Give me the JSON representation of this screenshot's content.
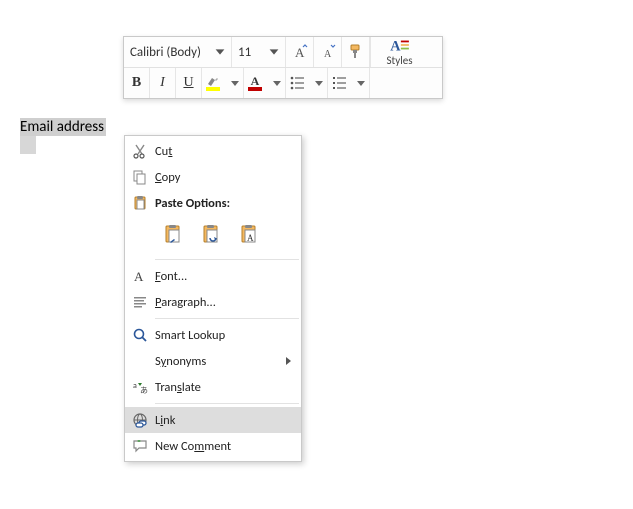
{
  "toolbar": {
    "font_name": "Calibri (Body)",
    "font_size": "11",
    "styles_label": "Styles"
  },
  "highlight_color": "#ffff00",
  "font_color": "#c00000",
  "accent_blue": "#2b579a",
  "selection_text": "Email address",
  "ctx": {
    "cut": "Cut",
    "copy": "Copy",
    "paste_hdr": "Paste Options:",
    "font": "Font...",
    "paragraph": "Paragraph...",
    "smart": "Smart Lookup",
    "syn": "Synonyms",
    "translate": "Translate",
    "link": "Link",
    "comment": "New Comment"
  }
}
